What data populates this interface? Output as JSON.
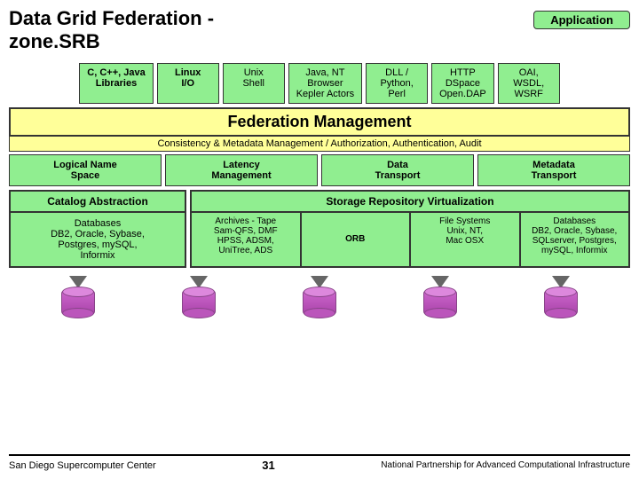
{
  "title": {
    "line1": "Data Grid Federation -",
    "line2": "zone.SRB"
  },
  "app_pill": "Application",
  "top_boxes": [
    {
      "label": "C, C++, Java\nLibraries"
    },
    {
      "label": "Linux\nI/O"
    },
    {
      "label": "Unix\nShell"
    },
    {
      "label": "Java, NT\nBrowser\nKepler Actors"
    },
    {
      "label": "DLL /\nPython,\nPerl"
    },
    {
      "label": "HTTP\nDSpace\nOpen.DAP"
    },
    {
      "label": "OAI,\nWSDL,\nWSRF"
    }
  ],
  "federation_mgmt": "Federation Management",
  "consistency": "Consistency  &  Metadata Management / Authorization, Authentication, Audit",
  "mid_boxes": [
    {
      "label": "Logical Name\nSpace"
    },
    {
      "label": "Latency\nManagement"
    },
    {
      "label": "Data\nTransport"
    },
    {
      "label": "Metadata\nTransport"
    }
  ],
  "catalog": {
    "header": "Catalog Abstraction",
    "body": "Databases\nDB2, Oracle, Sybase,\nPostgres, mySQL,\nInformix"
  },
  "storage": {
    "header": "Storage Repository Virtualization",
    "subs": [
      {
        "text": "Archives - Tape\nSam-QFS, DMF\nHPSS, ADSM,\nUniTree, ADS"
      },
      {
        "text": "ORB"
      },
      {
        "text": "File Systems\nUnix, NT,\nMac OSX"
      },
      {
        "text": "Databases\nDB2, Oracle, Sybase,\nSQLserver, Postgres,\nmySQL, Informix"
      }
    ]
  },
  "footer": {
    "left": "San Diego Supercomputer Center",
    "center": "31",
    "right": "National Partnership for Advanced Computational Infrastructure"
  }
}
